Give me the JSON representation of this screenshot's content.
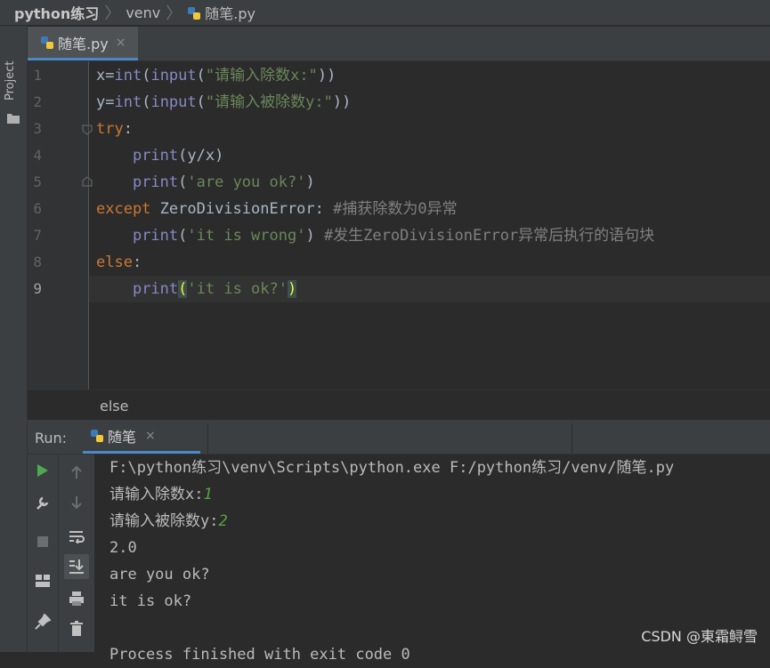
{
  "breadcrumb": {
    "project": "python练习",
    "folder": "venv",
    "file": "随笔.py"
  },
  "sidebar": {
    "project_label": "Project"
  },
  "editor_tab": {
    "label": "随笔.py",
    "close": "×"
  },
  "editor": {
    "line_numbers": [
      "1",
      "2",
      "3",
      "4",
      "5",
      "6",
      "7",
      "8",
      "9"
    ],
    "lines": {
      "l1": {
        "a": "x=",
        "fn1": "int",
        "b": "(",
        "fn2": "input",
        "c": "(",
        "str": "\"请输入除数x:\"",
        "d": "))"
      },
      "l2": {
        "a": "y=",
        "fn1": "int",
        "b": "(",
        "fn2": "input",
        "c": "(",
        "str": "\"请输入被除数y:\"",
        "d": "))"
      },
      "l3": {
        "kw": "try",
        "a": ":"
      },
      "l4": {
        "indent": "    ",
        "fn": "print",
        "a": "(y/x)"
      },
      "l5": {
        "indent": "    ",
        "fn": "print",
        "a": "(",
        "str": "'are you ok?'",
        "b": ")"
      },
      "l6": {
        "kw": "except",
        "a": " ZeroDivisionError: ",
        "cmt": "#捕获除数为0异常"
      },
      "l7": {
        "indent": "    ",
        "fn": "print",
        "a": "(",
        "str": "'it is wrong'",
        "b": ") ",
        "cmt": "#发生ZeroDivisionError异常后执行的语句块"
      },
      "l8": {
        "kw": "else",
        "a": ":"
      },
      "l9": {
        "indent": "    ",
        "fn": "print",
        "a": "(",
        "str": "'it is ok?'",
        "b": ")"
      }
    }
  },
  "code_breadcrumb": "else",
  "run_panel": {
    "title": "Run:",
    "tab_label": "随笔",
    "close": "×",
    "output": {
      "cmd": "F:\\python练习\\venv\\Scripts\\python.exe F:/python练习/venv/随笔.py",
      "prompt1": "请输入除数x:",
      "input1": "1",
      "prompt2": "请输入被除数y:",
      "input2": "2",
      "result": "2.0",
      "msg1": "are you ok?",
      "msg2": "it is ok?",
      "finish": "Process finished with exit code 0"
    }
  },
  "watermark": "CSDN @東霜鲟雪",
  "colors": {
    "background": "#2b2b2b",
    "keyword": "#cc7832",
    "builtin": "#8888c6",
    "string": "#6a8759",
    "comment": "#808080",
    "user_input": "#56a33f",
    "accent": "#4a88c7"
  }
}
